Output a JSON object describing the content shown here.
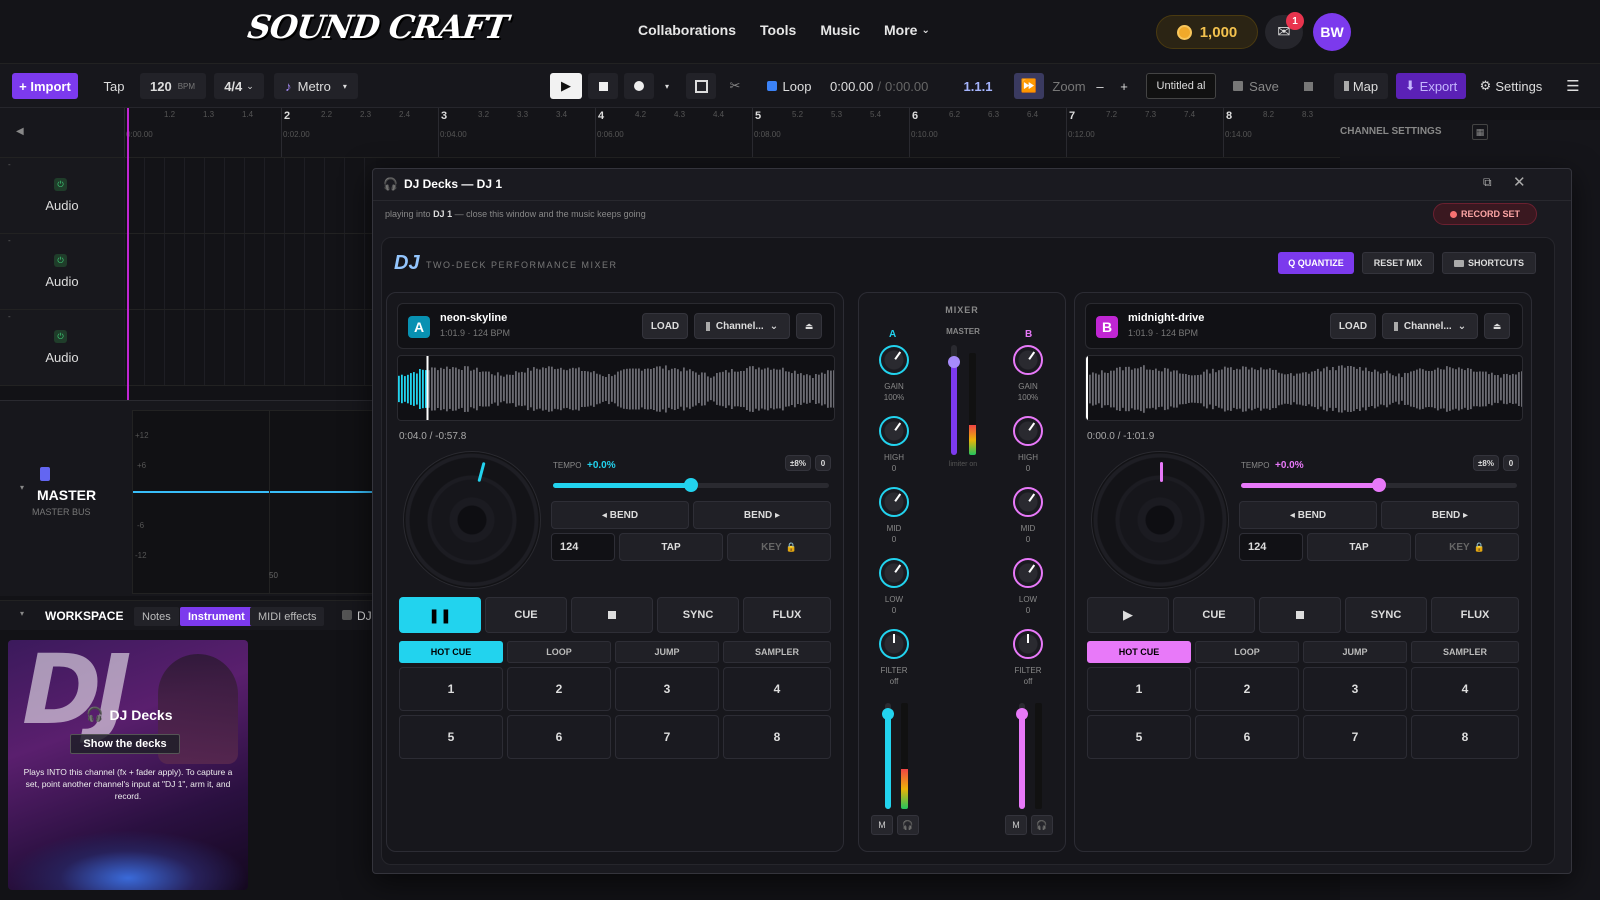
{
  "app": {
    "logo": "SOUND CRAFT"
  },
  "nav": {
    "links": [
      "Collaborations",
      "Tools",
      "Music",
      "More"
    ],
    "coins": "1,000",
    "mail_badge": "1",
    "avatar": "BW"
  },
  "toolbar": {
    "import": "+ Import",
    "tap": "Tap",
    "bpm": "120",
    "bpm_unit": "BPM",
    "time_sig": "4/4",
    "metro": "Metro",
    "loop": "Loop",
    "time_current": "0:00.00",
    "time_sep": "/",
    "time_total": "0:00.00",
    "position": "1.1.1",
    "zoom": "Zoom",
    "zoom_minus": "–",
    "zoom_plus": "+",
    "project_name": "Untitled al",
    "save": "Save",
    "map": "Map",
    "export": "Export",
    "settings": "Settings"
  },
  "ruler": {
    "bars": [
      "2",
      "3",
      "4",
      "5",
      "6",
      "7",
      "8"
    ],
    "bar_times": [
      "0:00.00",
      "0:02.00",
      "0:04.00",
      "0:06.00",
      "0:08.00",
      "0:10.00",
      "0:12.00",
      "0:14.00"
    ],
    "subdivs": [
      "1.2",
      "1.3",
      "1.4",
      "2.2",
      "2.3",
      "2.4",
      "3.2",
      "3.3",
      "3.4",
      "4.2",
      "4.3",
      "4.4",
      "5.2",
      "5.3",
      "5.4",
      "6.2",
      "6.3",
      "6.4",
      "7.2",
      "7.3",
      "7.4",
      "8.2",
      "8.3"
    ]
  },
  "tracks": [
    {
      "label": "Audio"
    },
    {
      "label": "Audio"
    },
    {
      "label": "Audio"
    }
  ],
  "master": {
    "title": "MASTER",
    "subtitle": "MASTER BUS",
    "scale": [
      "+12",
      "+6",
      "-6",
      "-12"
    ],
    "axis_label": "50"
  },
  "workspace": {
    "title": "WORKSPACE",
    "tabs": [
      "Notes",
      "Instrument",
      "MIDI effects"
    ],
    "active_tab": "Instrument",
    "dj_label": "DJ"
  },
  "card": {
    "bigtext": "DJ",
    "title": "DJ Decks",
    "button": "Show the decks",
    "desc": "Plays INTO this channel (fx + fader apply). To capture a set, point another channel's input at \"DJ 1\", arm it, and record."
  },
  "channel_settings": {
    "title": "CHANNEL SETTINGS"
  },
  "dj_window": {
    "title": "DJ Decks — DJ 1",
    "hint_prefix": "playing into",
    "hint_target": "DJ 1",
    "hint_suffix": "— close this window and the music keeps going",
    "record_set": "RECORD SET",
    "logo": "DJ",
    "subtitle": "TWO-DECK PERFORMANCE MIXER",
    "quantize": "Q QUANTIZE",
    "reset_mix": "RESET MIX",
    "shortcuts": "SHORTCUTS"
  },
  "deck_a": {
    "letter": "A",
    "track": "neon-skyline",
    "meta": "1:01.9 · 124 BPM",
    "load": "LOAD",
    "channel": "Channel...",
    "time": "0:04.0 / -0:57.8",
    "tempo_label": "TEMPO",
    "tempo_value": "+0.0%",
    "tempo_range": "±8%",
    "tempo_reset": "0",
    "tempo_fraction": 0.5,
    "bend_left": "◂ BEND",
    "bend_right": "BEND ▸",
    "bpm": "124",
    "tap": "TAP",
    "key": "KEY",
    "cue": "CUE",
    "sync": "SYNC",
    "flux": "FLUX",
    "tabs": [
      "HOT CUE",
      "LOOP",
      "JUMP",
      "SAMPLER"
    ],
    "pads": [
      "1",
      "2",
      "3",
      "4",
      "5",
      "6",
      "7",
      "8"
    ],
    "color": "#22d3ee"
  },
  "deck_b": {
    "letter": "B",
    "track": "midnight-drive",
    "meta": "1:01.9 · 124 BPM",
    "load": "LOAD",
    "channel": "Channel...",
    "time": "0:00.0 / -1:01.9",
    "tempo_label": "TEMPO",
    "tempo_value": "+0.0%",
    "tempo_range": "±8%",
    "tempo_reset": "0",
    "tempo_fraction": 0.5,
    "bend_left": "◂ BEND",
    "bend_right": "BEND ▸",
    "bpm": "124",
    "tap": "TAP",
    "key": "KEY",
    "cue": "CUE",
    "sync": "SYNC",
    "flux": "FLUX",
    "tabs": [
      "HOT CUE",
      "LOOP",
      "JUMP",
      "SAMPLER"
    ],
    "pads": [
      "1",
      "2",
      "3",
      "4",
      "5",
      "6",
      "7",
      "8"
    ],
    "color": "#e879f9"
  },
  "mixer": {
    "title": "MIXER",
    "ch_a": "A",
    "ch_b": "B",
    "master": "MASTER",
    "limiter": "limiter on",
    "gain": "GAIN",
    "gain_val": "100%",
    "high": "HIGH",
    "high_val": "0",
    "mid": "MID",
    "mid_val": "0",
    "low": "LOW",
    "low_val": "0",
    "filter": "FILTER",
    "filter_val": "off",
    "m": "M",
    "fader_a": 0.9,
    "fader_b": 0.9,
    "master_level": 0.85
  },
  "icons": {
    "headphones": "headphones-icon",
    "close": "close-icon",
    "popout": "popout-icon",
    "play": "play-icon",
    "stop": "stop-icon",
    "record": "record-icon",
    "pause": "pause-icon",
    "lock": "lock-icon",
    "eject": "eject-icon"
  }
}
